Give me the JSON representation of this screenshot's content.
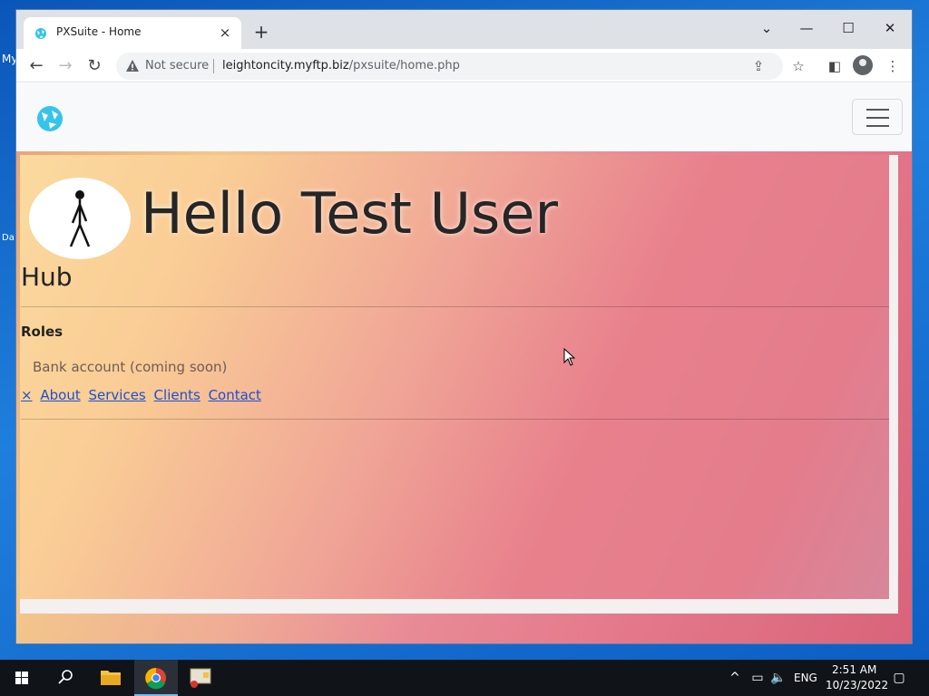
{
  "browser": {
    "tab_title": "PXSuite - Home",
    "tab_close": "×",
    "new_tab": "+",
    "window_controls": {
      "dropdown": "⌄",
      "minimize": "—",
      "maximize": "☐",
      "close": "✕"
    },
    "nav": {
      "back": "←",
      "forward": "→",
      "reload": "↻"
    },
    "security_label": "Not secure",
    "url_host": "leightoncity.myftp.biz",
    "url_path": "/pxsuite/home.php",
    "icons": [
      "share-icon",
      "bookmark-star-icon",
      "side-panel-icon",
      "profile-icon",
      "menu-kebab-icon"
    ]
  },
  "page": {
    "greeting": "Hello Test User",
    "section_title": "Hub",
    "roles_heading": "Roles",
    "roles": [
      "Bank account (coming soon)"
    ],
    "links": {
      "close": "×",
      "about": "About",
      "services": "Services",
      "clients": "Clients",
      "contact": "Contact"
    }
  },
  "taskbar": {
    "language": "ENG",
    "time": "2:51 AM",
    "date": "10/23/2022",
    "apps": [
      "start-icon",
      "search-icon",
      "file-explorer-icon",
      "chrome-icon",
      "app-icon"
    ]
  },
  "colors": {
    "link": "#1e4fd0",
    "taskbar": "#101418",
    "desktop": "#1f7fdc"
  }
}
